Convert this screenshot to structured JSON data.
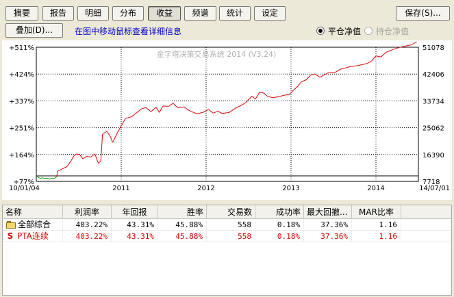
{
  "tabs": [
    {
      "label": "摘要",
      "active": false
    },
    {
      "label": "报告",
      "active": false
    },
    {
      "label": "明细",
      "active": false
    },
    {
      "label": "分布",
      "active": false
    },
    {
      "label": "收益",
      "active": true
    },
    {
      "label": "频谱",
      "active": false
    },
    {
      "label": "统计",
      "active": false
    },
    {
      "label": "设定",
      "active": false
    }
  ],
  "toolbar": {
    "save_label": "保存(S)...",
    "overlay_label": "叠加(D)...",
    "hint": "在图中移动鼠标查看详细信息"
  },
  "radios": {
    "flat_label": "平仓净值",
    "flat_checked": true,
    "open_label": "持仓净值",
    "open_checked": false
  },
  "chart_data": {
    "type": "line",
    "watermark": "金字塔决策交易系统 2014 (V3.24)",
    "x_start_label": "10/01/04",
    "x_end_label": "14/07/01",
    "x_ticks": [
      "2011",
      "2012",
      "2013",
      "2014"
    ],
    "y_left_ticks": [
      "+511%",
      "+424%",
      "+337%",
      "+251%",
      "+164%",
      "+77%"
    ],
    "y_right_ticks": [
      "51078",
      "42406",
      "33734",
      "25062",
      "16390",
      "7718"
    ],
    "ylim": [
      77,
      511
    ],
    "baseline": 77,
    "x_range": [
      2010.0,
      2014.5
    ],
    "colors": {
      "above": "#e00000",
      "below": "#00a000",
      "frame": "#000000",
      "grid": "#000000",
      "baseline": "#000000"
    },
    "series": [
      {
        "values": [
          [
            2010.0,
            77
          ],
          [
            2010.025,
            72
          ],
          [
            2010.05,
            69
          ],
          [
            2010.075,
            71
          ],
          [
            2010.1,
            68
          ],
          [
            2010.125,
            70
          ],
          [
            2010.155,
            66
          ],
          [
            2010.18,
            70
          ],
          [
            2010.21,
            68
          ],
          [
            2010.24,
            75
          ],
          [
            2010.25,
            92
          ],
          [
            2010.31,
            100
          ],
          [
            2010.36,
            107
          ],
          [
            2010.41,
            126
          ],
          [
            2010.44,
            141
          ],
          [
            2010.475,
            148
          ],
          [
            2010.51,
            146
          ],
          [
            2010.55,
            132
          ],
          [
            2010.59,
            140
          ],
          [
            2010.64,
            138
          ],
          [
            2010.69,
            148
          ],
          [
            2010.73,
            118
          ],
          [
            2010.76,
            125
          ],
          [
            2010.78,
            212
          ],
          [
            2010.83,
            221
          ],
          [
            2010.87,
            205
          ],
          [
            2010.9,
            185
          ],
          [
            2010.96,
            219
          ],
          [
            2011.01,
            243
          ],
          [
            2011.05,
            263
          ],
          [
            2011.12,
            268
          ],
          [
            2011.19,
            283
          ],
          [
            2011.24,
            294
          ],
          [
            2011.29,
            298
          ],
          [
            2011.35,
            285
          ],
          [
            2011.41,
            299
          ],
          [
            2011.45,
            282
          ],
          [
            2011.49,
            303
          ],
          [
            2011.56,
            302
          ],
          [
            2011.61,
            312
          ],
          [
            2011.67,
            297
          ],
          [
            2011.74,
            300
          ],
          [
            2011.81,
            287
          ],
          [
            2011.89,
            278
          ],
          [
            2011.96,
            282
          ],
          [
            2012.03,
            292
          ],
          [
            2012.08,
            280
          ],
          [
            2012.14,
            286
          ],
          [
            2012.19,
            279
          ],
          [
            2012.27,
            282
          ],
          [
            2012.34,
            295
          ],
          [
            2012.42,
            306
          ],
          [
            2012.47,
            315
          ],
          [
            2012.54,
            335
          ],
          [
            2012.58,
            325
          ],
          [
            2012.63,
            348
          ],
          [
            2012.68,
            345
          ],
          [
            2012.72,
            335
          ],
          [
            2012.78,
            330
          ],
          [
            2012.85,
            333
          ],
          [
            2012.92,
            338
          ],
          [
            2012.98,
            340
          ],
          [
            2013.03,
            355
          ],
          [
            2013.08,
            367
          ],
          [
            2013.12,
            381
          ],
          [
            2013.18,
            388
          ],
          [
            2013.23,
            403
          ],
          [
            2013.28,
            407
          ],
          [
            2013.34,
            396
          ],
          [
            2013.38,
            402
          ],
          [
            2013.44,
            411
          ],
          [
            2013.52,
            412
          ],
          [
            2013.58,
            422
          ],
          [
            2013.64,
            426
          ],
          [
            2013.7,
            431
          ],
          [
            2013.77,
            433
          ],
          [
            2013.84,
            437
          ],
          [
            2013.9,
            441
          ],
          [
            2013.95,
            449
          ],
          [
            2014.0,
            465
          ],
          [
            2014.06,
            462
          ],
          [
            2014.12,
            477
          ],
          [
            2014.2,
            486
          ],
          [
            2014.28,
            493
          ],
          [
            2014.35,
            497
          ],
          [
            2014.42,
            501
          ],
          [
            2014.48,
            511
          ]
        ]
      }
    ]
  },
  "table": {
    "headers": [
      "名称",
      "利润率",
      "年回报",
      "胜率",
      "交易数",
      "成功率",
      "最大回撤...",
      "MAR比率"
    ],
    "rows": [
      {
        "icon": "folder-icon",
        "name": "全部综合",
        "profit": "403.22%",
        "annual": "43.31%",
        "win": "45.88%",
        "trades": "558",
        "success": "0.18%",
        "maxdd": "37.36%",
        "mar": "1.16",
        "color": "#000000"
      },
      {
        "icon": "strategy-s-icon",
        "name": "PTA连续",
        "profit": "403.22%",
        "annual": "43.31%",
        "win": "45.88%",
        "trades": "558",
        "success": "0.18%",
        "maxdd": "37.36%",
        "mar": "1.16",
        "color": "#d80000"
      }
    ]
  }
}
